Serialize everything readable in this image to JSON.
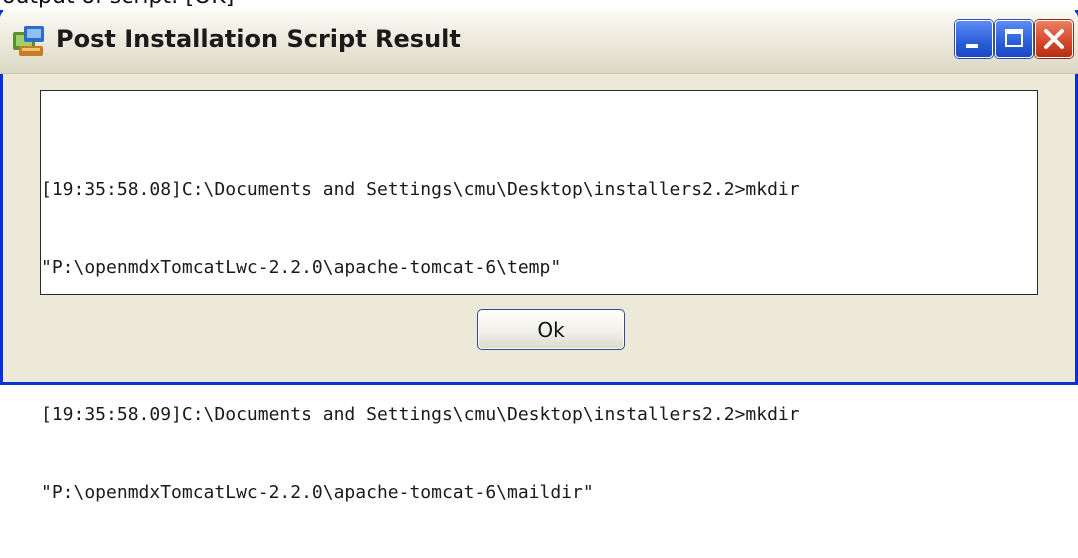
{
  "top_fragment": "output of script: [OK]",
  "window": {
    "title": "Post Installation Script Result",
    "icon": "installer-app-icon",
    "controls": {
      "minimize_icon": "minimize-icon",
      "maximize_icon": "maximize-icon",
      "close_icon": "close-icon"
    }
  },
  "output": {
    "lines": [
      "[19:35:58.08]C:\\Documents and Settings\\cmu\\Desktop\\installers2.2>mkdir",
      "\"P:\\openmdxTomcatLwc-2.2.0\\apache-tomcat-6\\temp\"",
      "[19:35:58.09]C:\\Documents and Settings\\cmu\\Desktop\\installers2.2>mkdir",
      "\"P:\\openmdxTomcatLwc-2.2.0\\apache-tomcat-6\\maildir\""
    ]
  },
  "buttons": {
    "ok_label": "Ok"
  },
  "colors": {
    "window_border": "#0831d9",
    "dialog_background": "#ece9d8",
    "close_button": "#d3462a",
    "window_button": "#2b5ed8"
  }
}
